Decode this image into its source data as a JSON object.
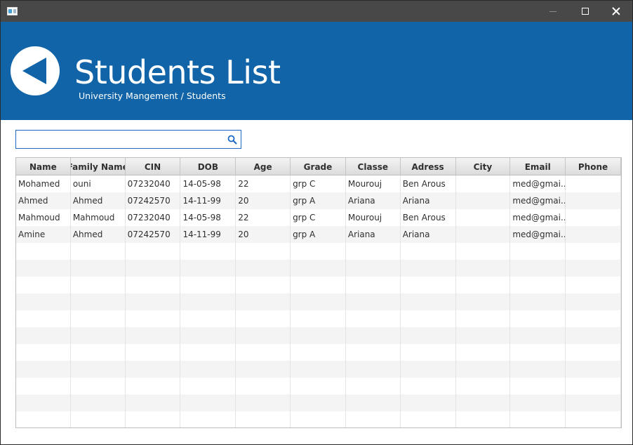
{
  "header": {
    "title": "Students List",
    "breadcrumb": "University Mangement / Students"
  },
  "search": {
    "value": "",
    "placeholder": ""
  },
  "table": {
    "columns": [
      "Name",
      "Family Name",
      "CIN",
      "DOB",
      "Age",
      "Grade",
      "Classe",
      "Adress",
      "City",
      "Email",
      "Phone"
    ],
    "rows": [
      [
        "Mohamed",
        "ouni",
        "07232040",
        "14-05-98",
        "22",
        "grp C",
        "Mourouj",
        "Ben Arous",
        "",
        "med@gmai...",
        ""
      ],
      [
        "Ahmed",
        "Ahmed",
        "07242570",
        "14-11-99",
        "20",
        "grp A",
        "Ariana",
        "Ariana",
        "",
        "med@gmai...",
        ""
      ],
      [
        "Mahmoud",
        "Mahmoud",
        "07232040",
        "14-05-98",
        "22",
        "grp C",
        "Mourouj",
        "Ben Arous",
        "",
        "med@gmai...",
        ""
      ],
      [
        "Amine",
        "Ahmed",
        "07242570",
        "14-11-99",
        "20",
        "grp A",
        "Ariana",
        "Ariana",
        "",
        "med@gmai...",
        ""
      ]
    ]
  },
  "colors": {
    "header_bg": "#1164a8",
    "titlebar_bg": "#494848",
    "search_border": "#1d68c2"
  },
  "icons": {
    "back": "back-arrow-icon",
    "search": "search-icon",
    "minimize": "minimize-icon",
    "maximize": "maximize-icon",
    "close": "close-icon"
  }
}
